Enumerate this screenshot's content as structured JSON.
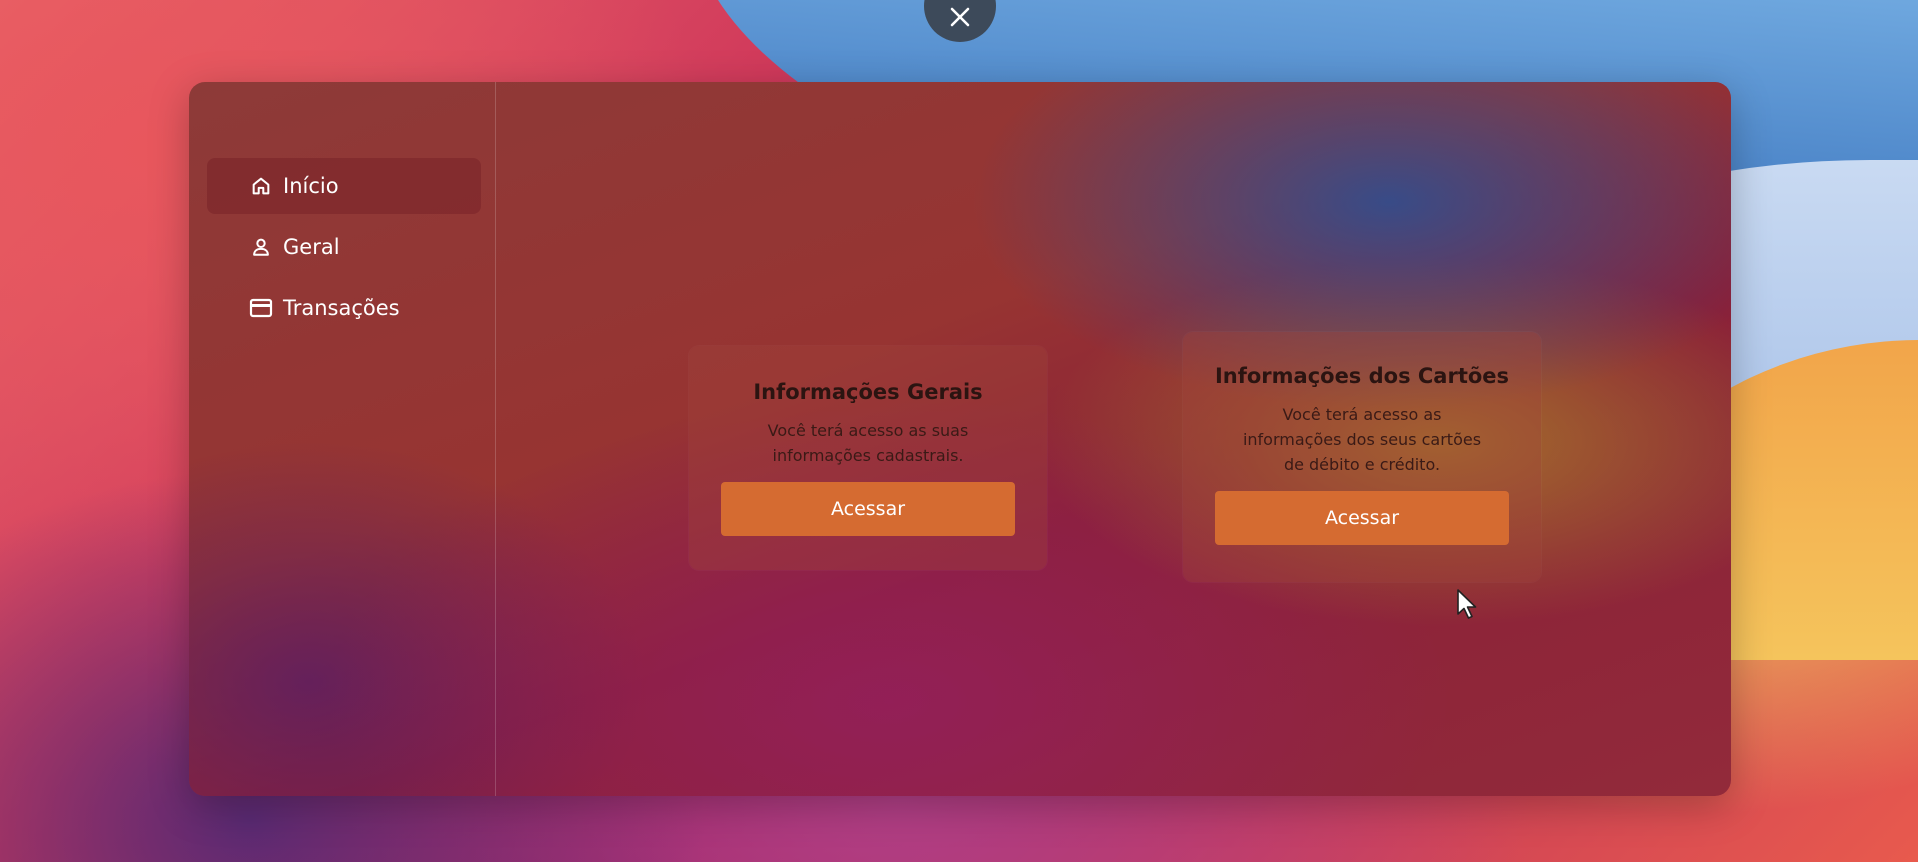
{
  "close_button": {
    "icon": "close-icon"
  },
  "sidebar": {
    "items": [
      {
        "label": "Início",
        "icon": "home-icon",
        "active": true
      },
      {
        "label": "Geral",
        "icon": "user-icon",
        "active": false
      },
      {
        "label": "Transações",
        "icon": "credit-card-icon",
        "active": false
      }
    ]
  },
  "cards": [
    {
      "title": "Informações Gerais",
      "description": "Você terá acesso as suas informações cadastrais.",
      "button_label": "Acessar"
    },
    {
      "title": "Informações dos Cartões",
      "description": "Você terá acesso as informações dos seus cartões de débito e crédito.",
      "button_label": "Acessar"
    }
  ],
  "colors": {
    "accent_button": "#d56b31",
    "close_button_bg": "#3d4a5a"
  }
}
